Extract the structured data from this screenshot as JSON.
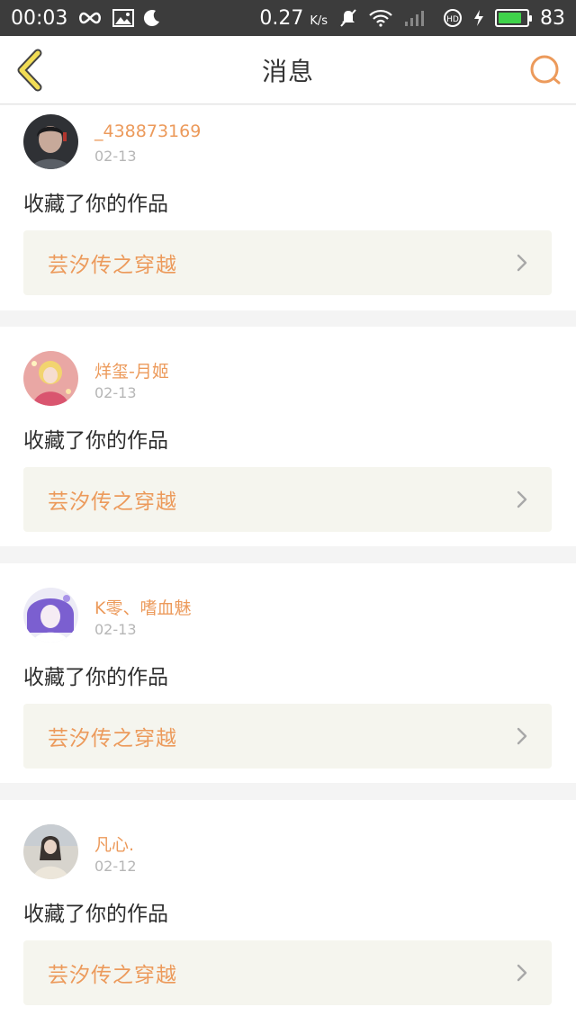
{
  "status_bar": {
    "time": "00:03",
    "speed_value": "0.27",
    "speed_unit": "K/s",
    "battery_level": "83",
    "battery_fraction": 0.83,
    "icons": [
      "infinity-icon",
      "image-icon",
      "moon-icon",
      "mute-icon",
      "wifi-icon",
      "signal-icon",
      "hd-icon",
      "charging-icon",
      "battery-icon"
    ]
  },
  "header": {
    "title": "消息",
    "back_icon": "chevron-left-icon",
    "search_icon": "search-icon",
    "accent": "#ec9a5b",
    "back_color": "#f2dd55"
  },
  "messages": [
    {
      "username": "_438873169",
      "date": "02-13",
      "action": "收藏了你的作品",
      "work_title": "芸汐传之穿越"
    },
    {
      "username": "烊玺-月姬",
      "date": "02-13",
      "action": "收藏了你的作品",
      "work_title": "芸汐传之穿越"
    },
    {
      "username": "K零、嗜血魅",
      "date": "02-13",
      "action": "收藏了你的作品",
      "work_title": "芸汐传之穿越"
    },
    {
      "username": "凡心.",
      "date": "02-12",
      "action": "收藏了你的作品",
      "work_title": "芸汐传之穿越"
    }
  ]
}
